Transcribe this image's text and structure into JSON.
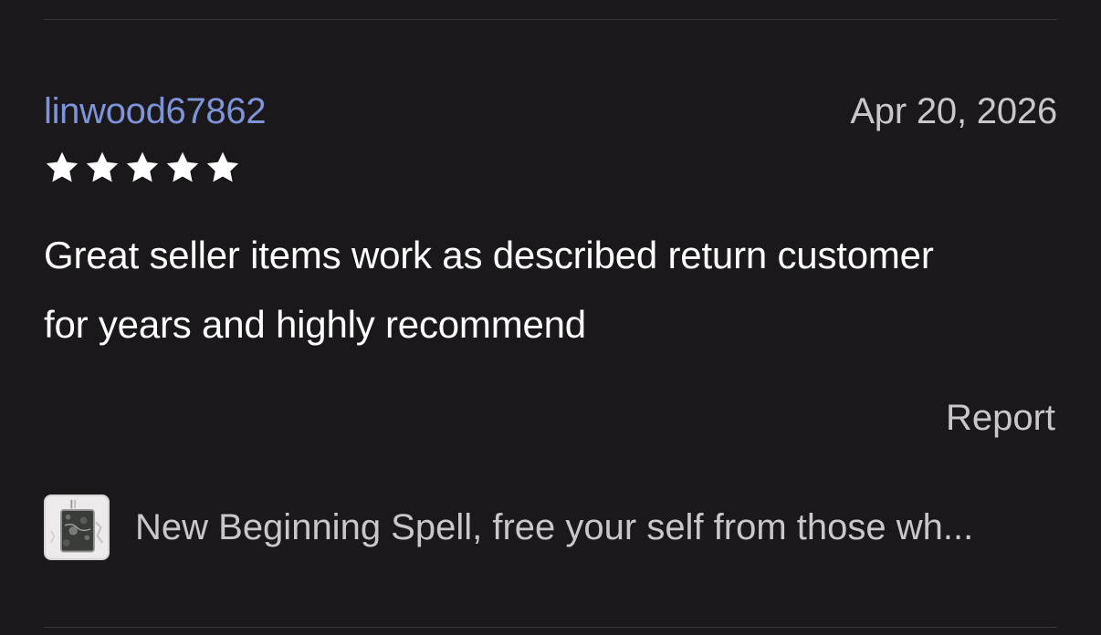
{
  "review": {
    "reviewer": "linwood67862",
    "date": "Apr 20, 2026",
    "rating": 5,
    "rating_max": 5,
    "text": "Great seller items work as described return customer for years and highly recommend",
    "report_label": "Report"
  },
  "product": {
    "title": "New Beginning Spell, free your self from those wh..."
  },
  "colors": {
    "background": "#1b181c",
    "reviewer_link": "#7f93d8",
    "muted_text": "#c9c7cc",
    "divider": "#3a373c"
  }
}
